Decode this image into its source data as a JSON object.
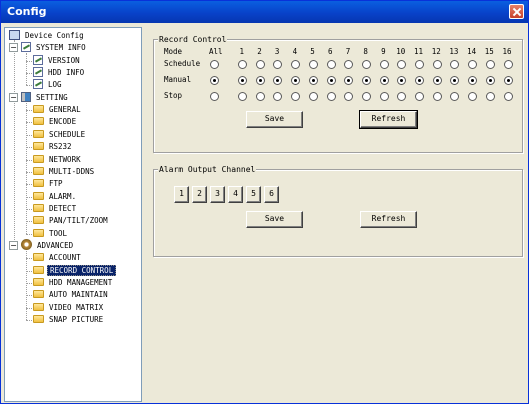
{
  "window": {
    "title": "Config"
  },
  "tree": {
    "root": "Device Config",
    "items": [
      {
        "label": "SYSTEM INFO",
        "icon": "doc-icon"
      },
      {
        "label": "VERSION",
        "icon": "doc-icon"
      },
      {
        "label": "HDD INFO",
        "icon": "doc-icon"
      },
      {
        "label": "LOG",
        "icon": "doc-icon"
      },
      {
        "label": "SETTING",
        "icon": "setting-icon"
      },
      {
        "label": "GENERAL",
        "icon": "folder-icon"
      },
      {
        "label": "ENCODE",
        "icon": "folder-icon"
      },
      {
        "label": "SCHEDULE",
        "icon": "folder-icon"
      },
      {
        "label": "RS232",
        "icon": "folder-icon"
      },
      {
        "label": "NETWORK",
        "icon": "folder-icon"
      },
      {
        "label": "MULTI-DDNS",
        "icon": "folder-icon"
      },
      {
        "label": "FTP",
        "icon": "folder-icon"
      },
      {
        "label": "ALARM.",
        "icon": "folder-icon"
      },
      {
        "label": "DETECT",
        "icon": "folder-icon"
      },
      {
        "label": "PAN/TILT/ZOOM",
        "icon": "folder-icon"
      },
      {
        "label": "TOOL",
        "icon": "folder-icon"
      },
      {
        "label": "ADVANCED",
        "icon": "gear-icon"
      },
      {
        "label": "ACCOUNT",
        "icon": "folder-icon"
      },
      {
        "label": "RECORD CONTROL",
        "icon": "folder-icon",
        "selected": true
      },
      {
        "label": "HDD MANAGEMENT",
        "icon": "folder-icon"
      },
      {
        "label": "AUTO MAINTAIN",
        "icon": "folder-icon"
      },
      {
        "label": "VIDEO MATRIX",
        "icon": "folder-icon"
      },
      {
        "label": "SNAP PICTURE",
        "icon": "folder-icon"
      }
    ]
  },
  "record_control": {
    "title": "Record Control",
    "mode_label": "Mode",
    "all_label": "All",
    "channels": [
      "1",
      "2",
      "3",
      "4",
      "5",
      "6",
      "7",
      "8",
      "9",
      "10",
      "11",
      "12",
      "13",
      "14",
      "15",
      "16"
    ],
    "rows": [
      {
        "label": "Schedule",
        "selected": false
      },
      {
        "label": "Manual",
        "selected": true
      },
      {
        "label": "Stop",
        "selected": false
      }
    ],
    "save_label": "Save",
    "refresh_label": "Refresh"
  },
  "alarm_output": {
    "title": "Alarm Output Channel",
    "channels": [
      "1",
      "2",
      "3",
      "4",
      "5",
      "6"
    ],
    "save_label": "Save",
    "refresh_label": "Refresh"
  }
}
